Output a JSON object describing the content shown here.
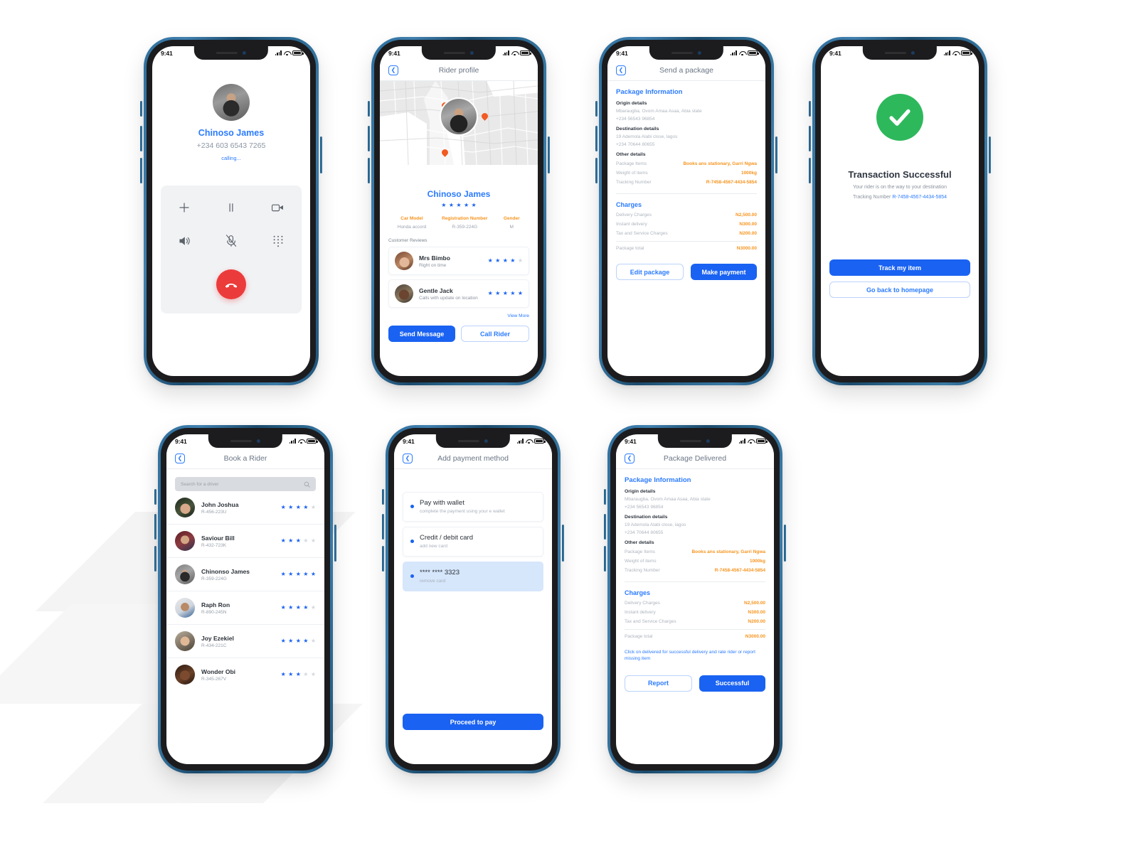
{
  "status_bar": {
    "time": "9:41"
  },
  "screens": {
    "call": {
      "name": "Chinoso James",
      "phone": "+234 603 6543 7265",
      "status": "calling...",
      "controls": [
        {
          "name": "add-call",
          "icon": "plus-icon"
        },
        {
          "name": "hold-call",
          "icon": "pause-icon"
        },
        {
          "name": "video-call",
          "icon": "video-camera-icon"
        },
        {
          "name": "speaker",
          "icon": "speaker-icon"
        },
        {
          "name": "mute",
          "icon": "microphone-muted-icon"
        },
        {
          "name": "keypad",
          "icon": "keypad-icon"
        }
      ],
      "end_call_label": "end-call"
    },
    "rider_profile": {
      "title": "Rider profile",
      "name": "Chinoso James",
      "rating": 5,
      "details": [
        {
          "header": "Car Model",
          "value": "Honda accord"
        },
        {
          "header": "Registration Number",
          "value": "R-359-224G"
        },
        {
          "header": "Gender",
          "value": "M"
        }
      ],
      "reviews_header": "Customer Reviews",
      "reviews": [
        {
          "name": "Mrs Bimbo",
          "comment": "Right on time",
          "rating": 4
        },
        {
          "name": "Gentle Jack",
          "comment": "Calls with update on location",
          "rating": 5
        }
      ],
      "view_more": "View More",
      "send_message": "Send Message",
      "call_rider": "Call Rider"
    },
    "send_package": {
      "title": "Send a package",
      "section_title": "Package Information",
      "origin_label": "Origin details",
      "origin_address": "Mbaraugba, Ovom Amaa Asaa, Abia state",
      "origin_phone": "+234 56543 96854",
      "destination_label": "Destination details",
      "destination_address": "19 Ademola Alabi close, lagos",
      "destination_phone": "+234 70644 80655",
      "other_label": "Other details",
      "other": [
        {
          "key": "Package Items",
          "value": "Books ans stationary, Garri Ngwa"
        },
        {
          "key": "Weight of items",
          "value": "1000kg"
        },
        {
          "key": "Tracking Number",
          "value": "R-7458-4567-4434-5854"
        }
      ],
      "charges_title": "Charges",
      "charges": [
        {
          "key": "Delivery Charges",
          "value": "N2,500.00"
        },
        {
          "key": "Instant delivery",
          "value": "N300.00"
        },
        {
          "key": "Tax and Service Charges",
          "value": "N200.00"
        }
      ],
      "total": {
        "key": "Package total",
        "value": "N3000.00"
      },
      "edit_label": "Edit package",
      "pay_label": "Make payment"
    },
    "success": {
      "icon": "check-circle-icon",
      "title": "Transaction Successful",
      "subtitle": "Your rider is on the way to your destination",
      "tracking_prefix": "Tracking Number ",
      "tracking_number": "R-7458-4567-4434-5854",
      "track_label": "Track my item",
      "home_label": "Go back to homepage"
    },
    "book_rider": {
      "title": "Book a Rider",
      "search_placeholder": "Search for a driver",
      "riders": [
        {
          "name": "John Joshua",
          "id": "R-456-223U",
          "rating": 4
        },
        {
          "name": "Saviour Bill",
          "id": "R-432-723K",
          "rating": 3
        },
        {
          "name": "Chinonso James",
          "id": "R-359-224G",
          "rating": 5
        },
        {
          "name": "Raph Ron",
          "id": "R-890-245N",
          "rating": 4
        },
        {
          "name": "Joy Ezekiel",
          "id": "R-434-221C",
          "rating": 4
        },
        {
          "name": "Wonder Obi",
          "id": "R-345-267V",
          "rating": 3
        }
      ]
    },
    "payment": {
      "title": "Add payment method",
      "methods": [
        {
          "title": "Pay with wallet",
          "subtitle": "complete the payment using your e wallet",
          "selected": false
        },
        {
          "title": "Credit / debit card",
          "subtitle": "add new card",
          "selected": false
        },
        {
          "title": "**** **** 3323",
          "subtitle": "remove card",
          "selected": true
        }
      ],
      "proceed_label": "Proceed to pay"
    },
    "delivered": {
      "title": "Package Delivered",
      "section_title": "Package Information",
      "origin_label": "Origin details",
      "origin_address": "Mbaraugba, Ovom Amaa Asaa, Abia state",
      "origin_phone": "+234 56543 96854",
      "destination_label": "Destination details",
      "destination_address": "19 Ademola Alabi close, lagos",
      "destination_phone": "+234 70644 80655",
      "other_label": "Other details",
      "other": [
        {
          "key": "Package Items",
          "value": "Books ans stationary, Garri Ngwa"
        },
        {
          "key": "Weight of items",
          "value": "1000kg"
        },
        {
          "key": "Tracking Number",
          "value": "R-7458-4567-4434-5854"
        }
      ],
      "charges_title": "Charges",
      "charges": [
        {
          "key": "Delivery Charges",
          "value": "N2,500.00"
        },
        {
          "key": "Instant delivery",
          "value": "N300.00"
        },
        {
          "key": "Tax and Service Charges",
          "value": "N200.00"
        }
      ],
      "total": {
        "key": "Package total",
        "value": "N3000.00"
      },
      "notice": "Click on  delivered for successful delivery and rate rider or report missing item",
      "report_label": "Report",
      "successful_label": "Successful"
    }
  },
  "colors": {
    "brand_blue": "#1a62f2",
    "link_blue": "#2b7bff",
    "accent_orange": "#f7941e",
    "success_green": "#2eb85c",
    "danger_red": "#ec3b3b",
    "star_on": "#1a62f2",
    "star_off": "#d3d8e0"
  }
}
